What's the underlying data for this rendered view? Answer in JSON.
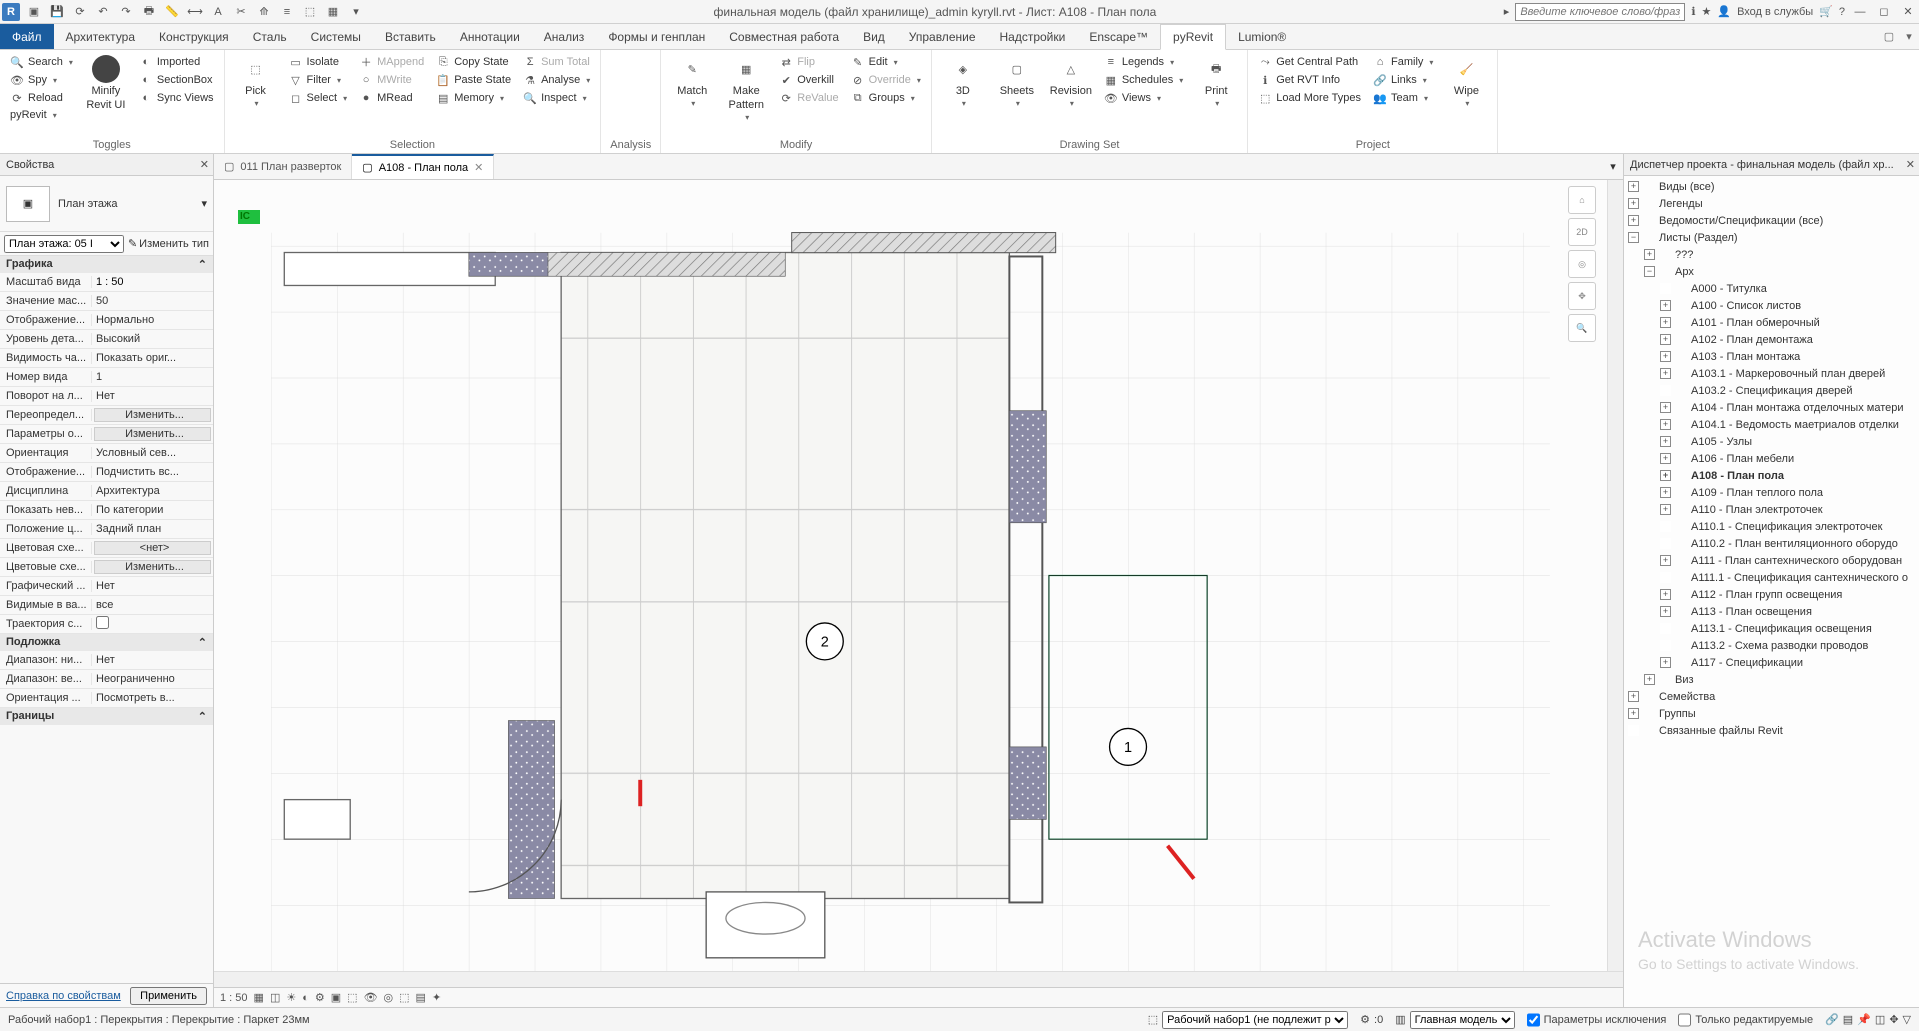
{
  "title": "финальная модель (файл хранилище)_admin kyryll.rvt - Лист: A108 - План пола",
  "search_placeholder": "Введите ключевое слово/фразу",
  "login_label": "Вход в службы",
  "menu": {
    "file": "Файл",
    "tabs": [
      "Архитектура",
      "Конструкция",
      "Сталь",
      "Системы",
      "Вставить",
      "Аннотации",
      "Анализ",
      "Формы и генплан",
      "Совместная работа",
      "Вид",
      "Управление",
      "Надстройки",
      "Enscape™",
      "pyRevit",
      "Lumion®"
    ],
    "active": "pyRevit"
  },
  "ribbon": {
    "toggles": {
      "label": "Toggles",
      "search": "Search",
      "spy": "Spy",
      "reload": "Reload",
      "pyrevit": "pyRevit",
      "imported": "Imported",
      "sectionbox": "SectionBox",
      "syncviews": "Sync Views",
      "minify": "Minify",
      "revitui": "Revit UI"
    },
    "selection": {
      "label": "Selection",
      "pick": "Pick",
      "isolate": "Isolate",
      "filter": "Filter",
      "select": "Select",
      "mappend": "MAppend",
      "mwrite": "MWrite",
      "mread": "MRead",
      "copystate": "Copy State",
      "pastestate": "Paste State",
      "memory": "Memory",
      "sumtotal": "Sum Total",
      "analyse": "Analyse",
      "inspect": "Inspect"
    },
    "analysis": {
      "label": "Analysis"
    },
    "modify": {
      "label": "Modify",
      "match": "Match",
      "make": "Make",
      "pattern": "Pattern",
      "flip": "Flip",
      "overkill": "Overkill",
      "revalue": "ReValue",
      "edit": "Edit",
      "override": "Override",
      "groups": "Groups"
    },
    "drawingset": {
      "label": "Drawing Set",
      "threeD": "3D",
      "sheets": "Sheets",
      "revision": "Revision",
      "legends": "Legends",
      "schedules": "Schedules",
      "views": "Views",
      "print": "Print"
    },
    "project": {
      "label": "Project",
      "getcentral": "Get Central Path",
      "getrvt": "Get RVT Info",
      "loadtypes": "Load More Types",
      "family": "Family",
      "links": "Links",
      "team": "Team",
      "wipe": "Wipe"
    }
  },
  "viewtabs": {
    "t1": "011 План разверток",
    "t2": "A108 - План пола"
  },
  "canvas": {
    "room1": "1",
    "room2": "2",
    "ic_label": "IC"
  },
  "props": {
    "title": "Свойства",
    "type": "План этажа",
    "instance": "План этажа: 05 I",
    "edit_type": "Изменить тип",
    "group1": "Графика",
    "rows": [
      {
        "k": "Масштаб вида",
        "v": "1 : 50",
        "mode": "input"
      },
      {
        "k": "Значение мас...",
        "v": "50"
      },
      {
        "k": "Отображение...",
        "v": "Нормально"
      },
      {
        "k": "Уровень дета...",
        "v": "Высокий"
      },
      {
        "k": "Видимость ча...",
        "v": "Показать ориг..."
      },
      {
        "k": "Номер вида",
        "v": "1"
      },
      {
        "k": "Поворот на л...",
        "v": "Нет"
      },
      {
        "k": "Переопредел...",
        "v": "Изменить...",
        "mode": "btn"
      },
      {
        "k": "Параметры о...",
        "v": "Изменить...",
        "mode": "btn"
      },
      {
        "k": "Ориентация",
        "v": "Условный сев..."
      },
      {
        "k": "Отображение...",
        "v": "Подчистить вс..."
      },
      {
        "k": "Дисциплина",
        "v": "Архитектура"
      },
      {
        "k": "Показать нев...",
        "v": "По категории"
      },
      {
        "k": "Положение ц...",
        "v": "Задний план"
      },
      {
        "k": "Цветовая схе...",
        "v": "<нет>",
        "mode": "btn"
      },
      {
        "k": "Цветовые схе...",
        "v": "Изменить...",
        "mode": "btn"
      },
      {
        "k": "Графический ...",
        "v": "Нет"
      },
      {
        "k": "Видимые в ва...",
        "v": "все"
      },
      {
        "k": "Траектория с...",
        "v": "",
        "mode": "check"
      }
    ],
    "group2": "Подложка",
    "rows2": [
      {
        "k": "Диапазон: ни...",
        "v": "Нет"
      },
      {
        "k": "Диапазон: ве...",
        "v": "Неограниченно"
      },
      {
        "k": "Ориентация ...",
        "v": "Посмотреть в..."
      }
    ],
    "group3": "Границы",
    "help": "Справка по свойствам",
    "apply": "Применить"
  },
  "browser": {
    "title": "Диспетчер проекта - финальная модель (файл хр...",
    "top": [
      {
        "t": "Виды (все)",
        "tw": "+",
        "ic": "views"
      },
      {
        "t": "Легенды",
        "tw": "+",
        "ic": "legend"
      },
      {
        "t": "Ведомости/Спецификации (все)",
        "tw": "+",
        "ic": "sched"
      },
      {
        "t": "Листы (Раздел)",
        "tw": "−",
        "ic": "sheets"
      }
    ],
    "sheets_children": [
      {
        "t": "???",
        "tw": "+",
        "lvl": 2
      },
      {
        "t": "Арх",
        "tw": "−",
        "lvl": 2
      }
    ],
    "arch": [
      "A000 - Титулка",
      "A100 - Список листов",
      "A101 - План обмерочный",
      "A102 - План демонтажа",
      "A103 - План монтажа",
      "A103.1 - Маркеровочный план дверей",
      "A103.2 - Спецификация дверей",
      "A104 - План монтажа отделочных матери",
      "A104.1 - Ведомость маетриалов отделки",
      "A105 - Узлы",
      "A106 - План мебели",
      "A108 - План пола",
      "A109 - План теплого пола",
      "A110 - План электроточек",
      "A110.1 - Спецификация электроточек",
      "A110.2 - План вентиляционного оборудо",
      "A111 - План сантехнического оборудован",
      "A111.1 - Спецификация сантехнического о",
      "A112 - План групп освещения",
      "A113 - План освещения",
      "A113.1 - Спецификация освещения",
      "A113.2 - Схема разводки проводов",
      "A117 - Спецификации"
    ],
    "arch_current": "A108 - План пола",
    "arch_expand": [
      "A100 - Список листов",
      "A101 - План обмерочный",
      "A102 - План демонтажа",
      "A103 - План монтажа",
      "A103.1 - Маркеровочный план дверей",
      "A104 - План монтажа отделочных матери",
      "A104.1 - Ведомость маетриалов отделки",
      "A105 - Узлы",
      "A106 - План мебели",
      "A108 - План пола",
      "A109 - План теплого пола",
      "A110 - План электроточек",
      "A111 - План сантехнического оборудован",
      "A112 - План групп освещения",
      "A113 - План освещения",
      "A117 - Спецификации"
    ],
    "bottom": [
      {
        "t": "Виз",
        "tw": "+",
        "lvl": 2
      },
      {
        "t": "Семейства",
        "tw": "+",
        "lvl": 1,
        "ic": "fam"
      },
      {
        "t": "Группы",
        "tw": "+",
        "lvl": 1,
        "ic": "grp"
      },
      {
        "t": "Связанные файлы Revit",
        "tw": "",
        "lvl": 1,
        "ic": "link"
      }
    ]
  },
  "viewbar": {
    "scale": "1 : 50"
  },
  "status": {
    "left": "Рабочий набор1 : Перекрытия : Перекрытие : Паркет 23мм",
    "ws": "Рабочий набор1 (не подлежит р",
    "zero": ":0",
    "model": "Главная модель",
    "excl": "Параметры исключения",
    "editable": "Только редактируемые"
  },
  "watermark": {
    "l1": "Activate Windows",
    "l2": "Go to Settings to activate Windows."
  }
}
